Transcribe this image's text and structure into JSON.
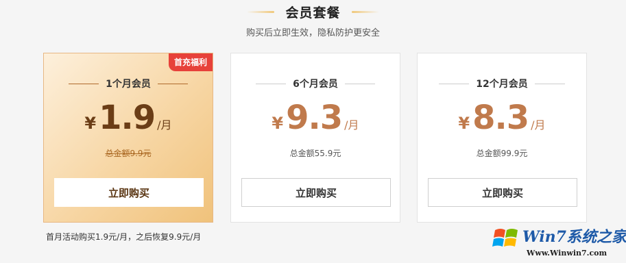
{
  "header": {
    "title": "会员套餐",
    "subtitle": "购买后立即生效，隐私防护更安全"
  },
  "plans": [
    {
      "badge": "首充福利",
      "name": "1个月会员",
      "currency": "¥",
      "price": "1.9",
      "unit": "/月",
      "total": "总金额9.9元",
      "button": "立即购买"
    },
    {
      "name": "6个月会员",
      "currency": "¥",
      "price": "9.3",
      "unit": "/月",
      "total": "总金额55.9元",
      "button": "立即购买"
    },
    {
      "name": "12个月会员",
      "currency": "¥",
      "price": "8.3",
      "unit": "/月",
      "total": "总金额99.9元",
      "button": "立即购买"
    }
  ],
  "note": "首月活动购买1.9元/月，之后恢复9.9元/月",
  "watermark": {
    "brand": "Win7系统之家",
    "url": "Www.Winwin7.com"
  },
  "colors": {
    "badge": "#e7413a",
    "price": "#c07a4c",
    "featured_price": "#6b3d16",
    "watermark_brand": "#1e5aa8"
  }
}
